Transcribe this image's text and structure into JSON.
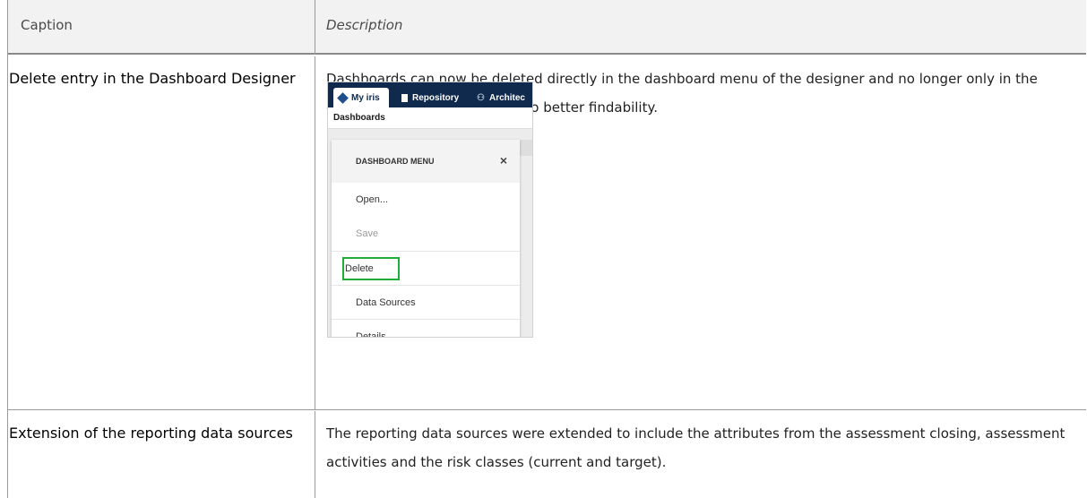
{
  "header": {
    "caption": "Caption",
    "description": "Description"
  },
  "rows": [
    {
      "caption": "Delete entry in the Dashboard Designer",
      "description": "Dashboards can now be deleted directly in the dashboard menu of the designer and no longer only in the dashboard management due to better findability.",
      "screenshot": {
        "tabs": [
          "My iris",
          "Repository",
          "Architec"
        ],
        "subbar": "Dashboards",
        "menu_title": "DASHBOARD MENU",
        "close_symbol": "×",
        "items": [
          "Open...",
          "Save",
          "Delete",
          "Data Sources",
          "Details"
        ],
        "highlight_color": "#1fae3c",
        "topbar_color": "#0f2a4d"
      }
    },
    {
      "caption": "Extension of the reporting data sources",
      "description": "The reporting data sources were extended to include the attributes from the assessment closing, assessment activities and the risk classes (current and target)."
    }
  ]
}
